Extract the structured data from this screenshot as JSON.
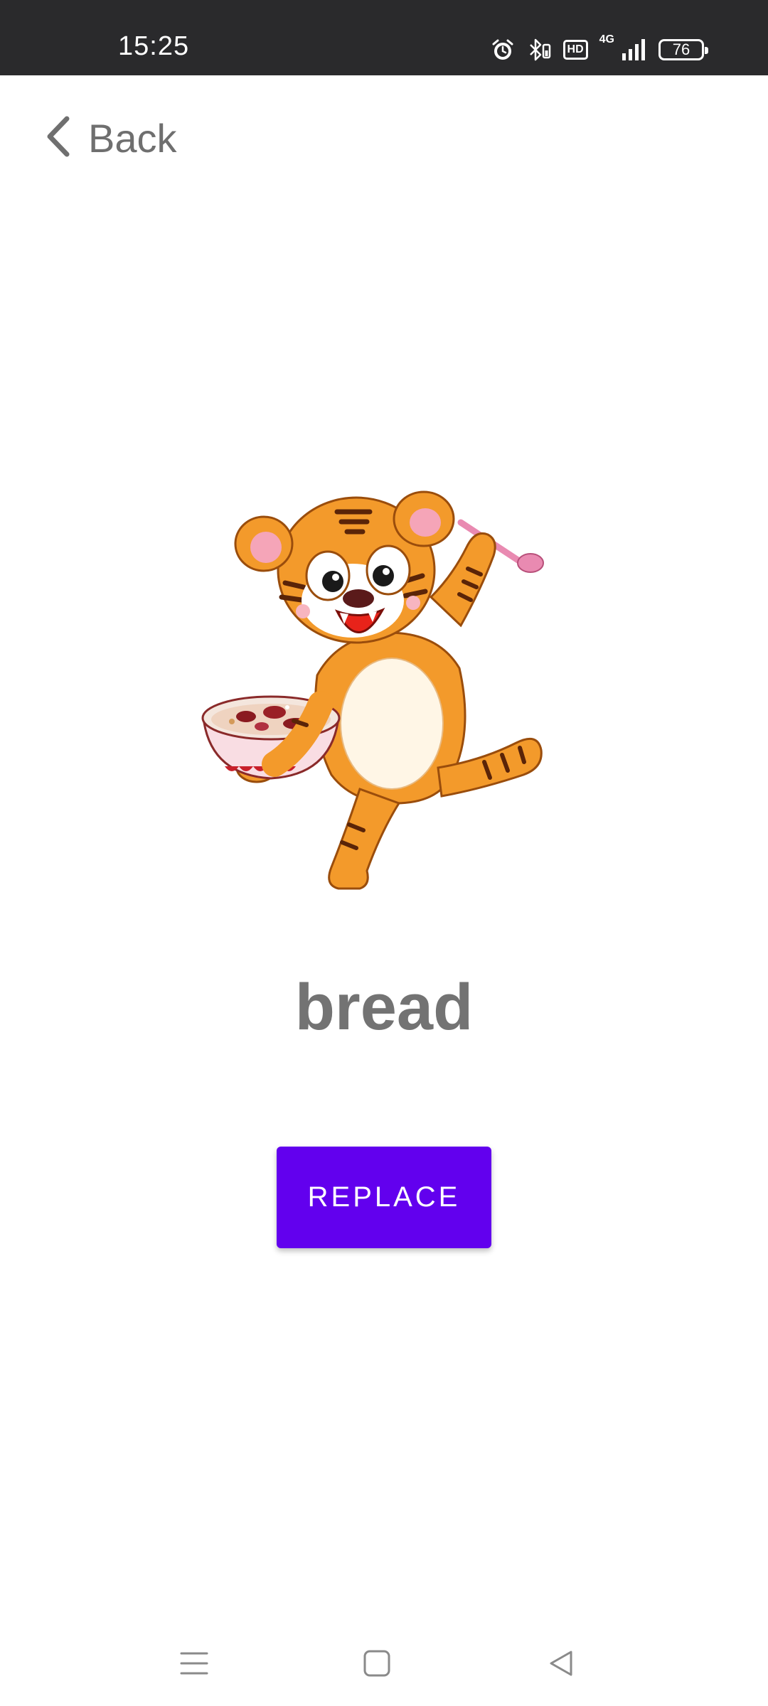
{
  "status_bar": {
    "time": "15:25",
    "icons": [
      "alarm-icon",
      "bluetooth-icon",
      "hd-icon",
      "4g-signal-icon",
      "battery-icon"
    ],
    "hd_label": "HD",
    "network_label": "4G",
    "battery_level": "76"
  },
  "header": {
    "back_label": "Back",
    "back_icon": "chevron-left-icon"
  },
  "card": {
    "image": "tiger-eating-porridge-illustration",
    "word": "bread"
  },
  "actions": {
    "replace_label": "REPLACE"
  },
  "nav_bar": {
    "items": [
      "menu-icon",
      "home-icon",
      "back-triangle-icon"
    ]
  },
  "colors": {
    "status_bar_bg": "#2a2a2c",
    "accent": "#6200ee",
    "text_gray": "#737373",
    "tiger_orange": "#f39a2b"
  }
}
